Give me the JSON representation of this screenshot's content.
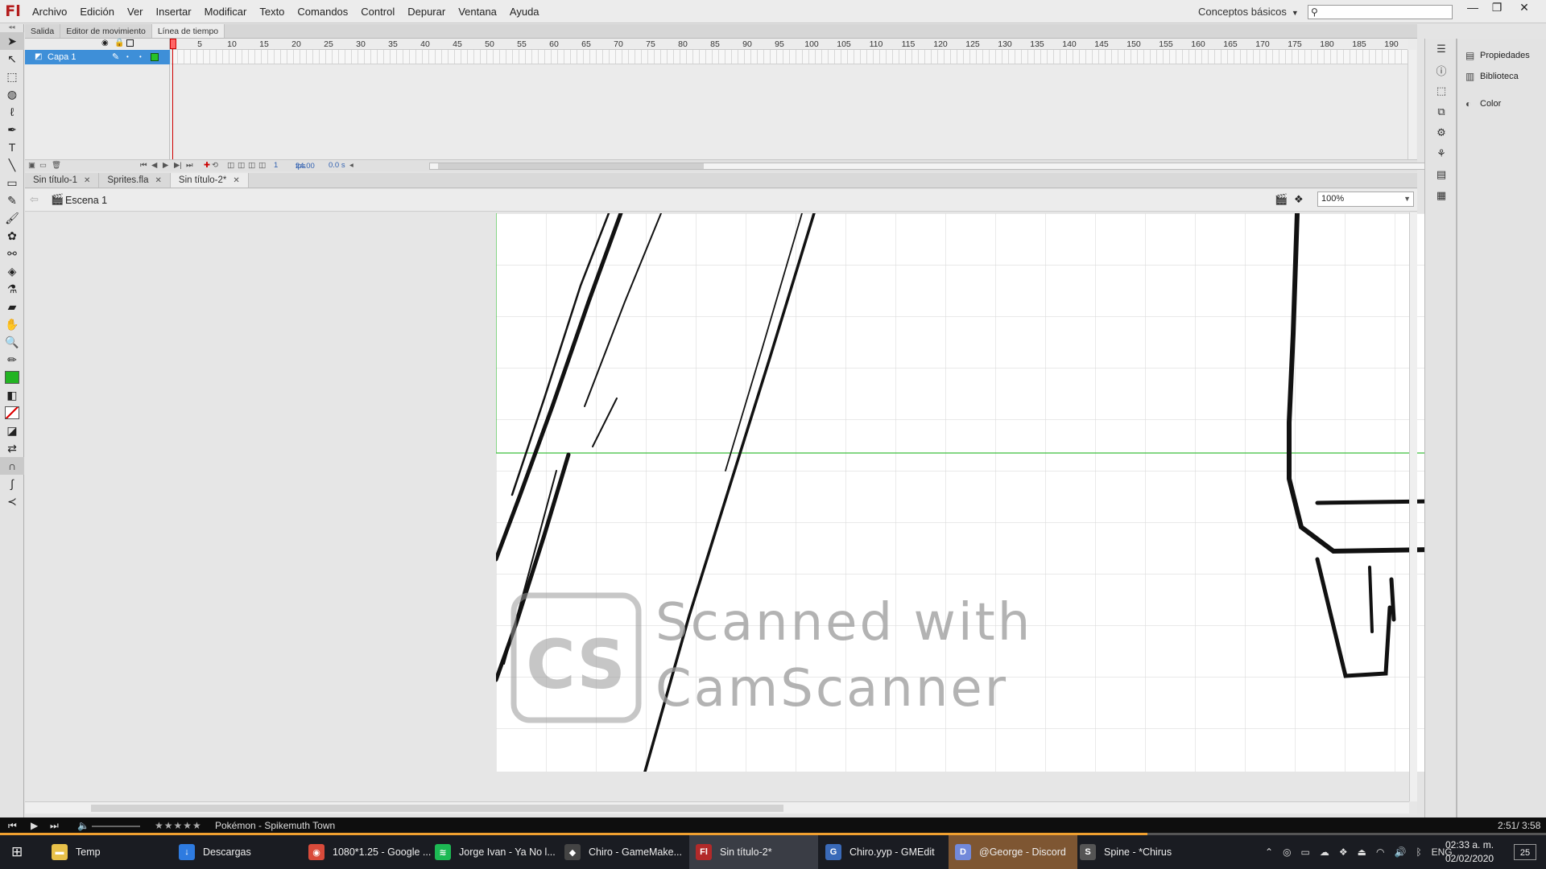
{
  "app": {
    "logo": "Fl",
    "menu": [
      "Archivo",
      "Edición",
      "Ver",
      "Insertar",
      "Modificar",
      "Texto",
      "Comandos",
      "Control",
      "Depurar",
      "Ventana",
      "Ayuda"
    ],
    "workspace": "Conceptos básicos",
    "search_placeholder": "",
    "window_controls": [
      "—",
      "❐",
      "✕"
    ]
  },
  "panel_tabs": [
    {
      "label": "Salida",
      "active": false
    },
    {
      "label": "Editor de movimiento",
      "active": false
    },
    {
      "label": "Línea de tiempo",
      "active": true
    }
  ],
  "timeline": {
    "ruler": [
      "1",
      "5",
      "10",
      "15",
      "20",
      "25",
      "30",
      "35",
      "40",
      "45",
      "50",
      "55",
      "60",
      "65",
      "70",
      "75",
      "80",
      "85",
      "90",
      "95",
      "100",
      "105",
      "110",
      "115",
      "120",
      "125",
      "130",
      "135",
      "140",
      "145",
      "150",
      "155",
      "160",
      "165",
      "170",
      "175",
      "180",
      "185",
      "190"
    ],
    "layer_name": "Capa 1",
    "current_frame": "1",
    "fps": "24.00",
    "fps_unit": "fps",
    "elapsed": "0.0 s"
  },
  "doc_tabs": [
    {
      "label": "Sin título-1",
      "active": false
    },
    {
      "label": "Sprites.fla",
      "active": false
    },
    {
      "label": "Sin título-2*",
      "active": true
    }
  ],
  "edit_bar": {
    "scene": "Escena 1",
    "zoom": "100%"
  },
  "artwork": {
    "watermark_line1": "Scanned with",
    "watermark_line2": "CamScanner",
    "logo_text": "CS"
  },
  "right_panel": [
    "Propiedades",
    "Biblioteca",
    "Color"
  ],
  "media_player": {
    "rating": "★★★★★",
    "track": "Pokémon - Spikemuth Town",
    "time": "2:51/ 3:58",
    "progress": 0.742
  },
  "taskbar": {
    "tasks": [
      {
        "label": "Temp",
        "icon": "folder-icon",
        "color": "#e8c14a",
        "glyph": "▬"
      },
      {
        "label": "Descargas",
        "icon": "download-icon",
        "color": "#2e7be0",
        "glyph": "↓"
      },
      {
        "label": "1080*1.25 - Google ...",
        "icon": "chrome-icon",
        "color": "#d94b3b",
        "glyph": "◉"
      },
      {
        "label": "Jorge Ivan - Ya No l...",
        "icon": "spotify-icon",
        "color": "#1db954",
        "glyph": "≋"
      },
      {
        "label": "Chiro - GameMake...",
        "icon": "gamemaker-icon",
        "color": "#444444",
        "glyph": "◆"
      },
      {
        "label": "Sin título-2*",
        "icon": "flash-icon",
        "color": "#b22a2a",
        "glyph": "Fl"
      },
      {
        "label": "Chiro.yyp - GMEdit",
        "icon": "gmedit-icon",
        "color": "#3a6ab8",
        "glyph": "G"
      },
      {
        "label": "@George - Discord",
        "icon": "discord-icon",
        "color": "#7289da",
        "glyph": "D"
      },
      {
        "label": "Spine - *Chirus",
        "icon": "spine-icon",
        "color": "#555555",
        "glyph": "S"
      }
    ],
    "tray_lang": "ENG",
    "clock_time": "02:33 a. m.",
    "clock_date": "02/02/2020",
    "notifications": "25"
  }
}
